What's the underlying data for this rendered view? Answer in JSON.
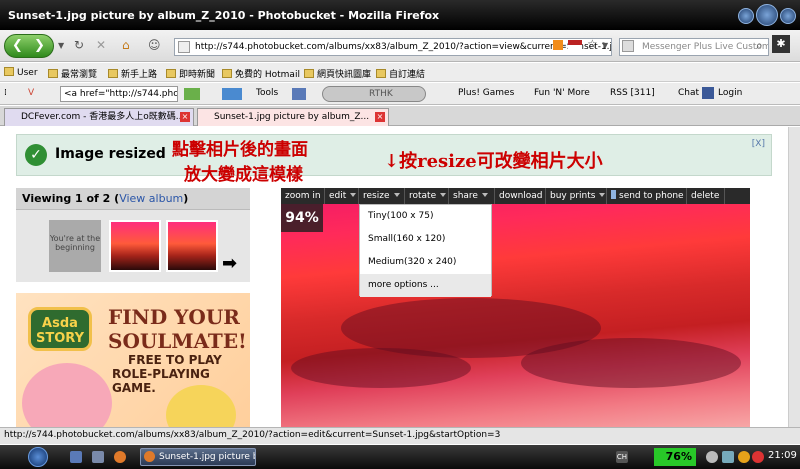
{
  "window": {
    "title": "Sunset-1.jpg picture by album_Z_2010 - Photobucket - Mozilla Firefox"
  },
  "navbar": {
    "url": "http://s744.photobucket.com/albums/xx83/album_Z_2010/?action=view&current=Sunset-1.jpg",
    "search_placeholder": "Messenger Plus Live Custom"
  },
  "bookmarks": [
    "User",
    "最常瀏覽",
    "新手上路",
    "即時新聞",
    "免費的 Hotmail",
    "網頁快訊圖庫",
    "自訂連結"
  ],
  "toolbar2": {
    "input_value": "<a href=\"http://s744.pho",
    "tools": "Tools",
    "rthk": "RTHK",
    "plus_games": "Plus! Games",
    "fun_more": "Fun 'N' More",
    "rss": "RSS [311]",
    "chat": "Chat",
    "login": "Login"
  },
  "tabs": [
    {
      "label": "DCFever.com - 香港最多人上o既數碼..."
    },
    {
      "label": "Sunset-1.jpg picture by album_Z..."
    }
  ],
  "banner": {
    "message": "Image resized",
    "close": "[X]"
  },
  "annotations": {
    "line1": "點擊相片後的畫面",
    "line2": "放大變成這模樣",
    "line3": "↓按resize可改變相片大小"
  },
  "album": {
    "viewing": "Viewing 1 of 2 (",
    "view_album": "View album",
    "viewing_close": ")",
    "beginning": "You're at the beginning"
  },
  "ad": {
    "logo": "Asda STORY",
    "line1": "FIND YOUR",
    "line1b": "SOULMATE!",
    "line2": "FREE TO PLAY",
    "line3": "ROLE-PLAYING GAME."
  },
  "photo_toolbar": {
    "items": [
      "zoom in",
      "edit",
      "resize",
      "rotate",
      "share",
      "download",
      "buy prints",
      "send to phone",
      "delete"
    ]
  },
  "zoom": "94%",
  "resize_menu": [
    "Tiny(100 x 75)",
    "Small(160 x 120)",
    "Medium(320 x 240)",
    "more options ..."
  ],
  "statusbar": {
    "text": "http://s744.photobucket.com/albums/xx83/album_Z_2010/?action=edit&current=Sunset-1.jpg&startOption=3"
  },
  "taskbar": {
    "task": "Sunset-1.jpg picture b...",
    "cpu": "76%",
    "clock": "21:09"
  },
  "colors": {
    "accent_red": "#cc0000",
    "banner_bg": "#dfeee6",
    "check_green": "#2f8f34",
    "cpu_green": "#28c828"
  }
}
